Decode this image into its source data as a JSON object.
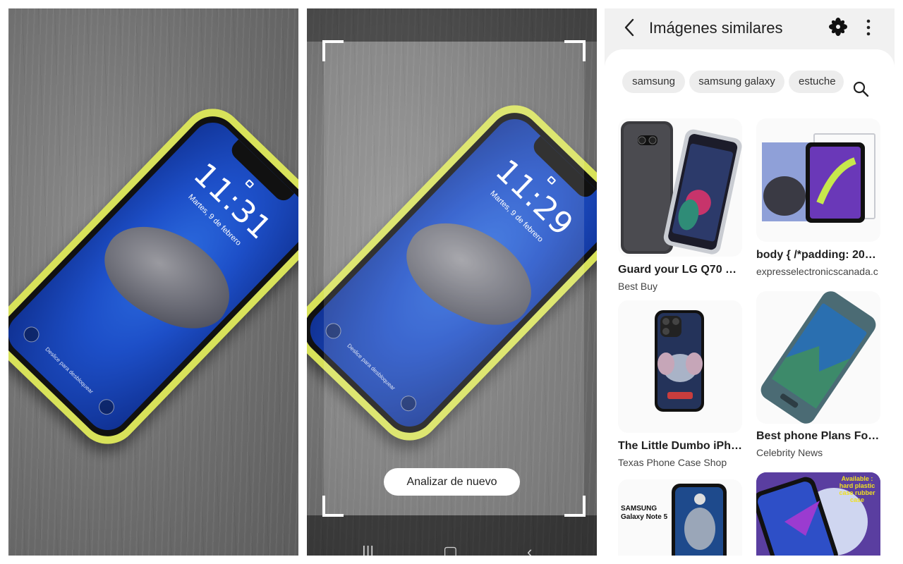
{
  "phone_lockscreen_left": {
    "time": "11:31",
    "date": "Martes, 9 de febrero",
    "hint": "Deslice para desbloquear"
  },
  "phone_lockscreen_middle": {
    "time": "11:29",
    "date": "Martes, 9 de febrero",
    "hint": "Deslice para desbloquear"
  },
  "scanner": {
    "reanalyze_label": "Analizar de nuevo"
  },
  "similar_images": {
    "title": "Imágenes similares",
    "chips": [
      "samsung",
      "samsung galaxy",
      "estuche"
    ],
    "results": [
      {
        "title": "Guard your LG Q70 ag...",
        "source": "Best Buy"
      },
      {
        "title": "body { /*padding: 20p...",
        "source": "expresselectronicscanada.c"
      },
      {
        "title": "The Little Dumbo iPho...",
        "source": "Texas Phone Case Shop"
      },
      {
        "title": "Best phone Plans For ...",
        "source": "Celebrity News"
      },
      {
        "title": "",
        "source": "",
        "thumb_text": "SAMSUNG Galaxy Note 5"
      },
      {
        "title": "",
        "source": "",
        "thumb_text": "Available : hard plastic case rubber case"
      }
    ]
  },
  "colors": {
    "case_yellow": "#d8e25a",
    "wallpaper_blue": "#1d4fc8",
    "header_bg": "#f1f1f1",
    "chip_bg": "#ededed"
  }
}
